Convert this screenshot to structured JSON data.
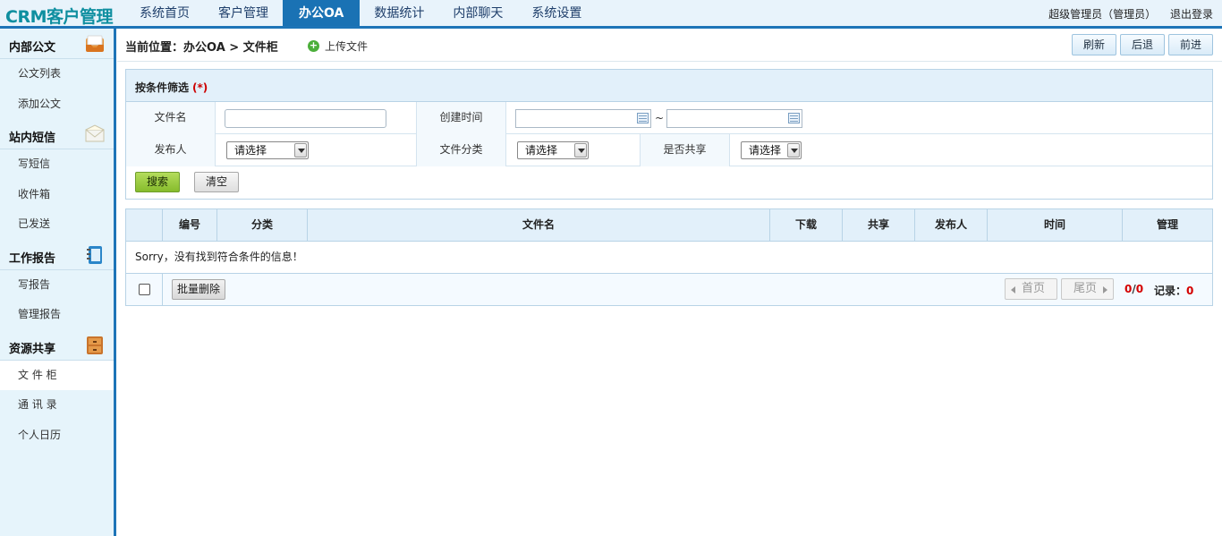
{
  "app": {
    "logo": "CRM客户管理"
  },
  "nav": {
    "items": [
      {
        "label": "系统首页"
      },
      {
        "label": "客户管理"
      },
      {
        "label": "办公OA",
        "active": true
      },
      {
        "label": "数据统计"
      },
      {
        "label": "内部聊天"
      },
      {
        "label": "系统设置"
      }
    ]
  },
  "user": {
    "name": "超级管理员（管理员）",
    "logout": "退出登录"
  },
  "sidebar": {
    "groups": [
      {
        "title": "内部公文",
        "icon": "inbox-tray-icon",
        "items": [
          "公文列表",
          "添加公文"
        ]
      },
      {
        "title": "站内短信",
        "icon": "envelope-icon",
        "items": [
          "写短信",
          "收件箱",
          "已发送"
        ]
      },
      {
        "title": "工作报告",
        "icon": "notebook-icon",
        "items": [
          "写报告",
          "管理报告"
        ]
      },
      {
        "title": "资源共享",
        "icon": "cabinet-icon",
        "items": [
          "文 件 柜",
          "通 讯 录",
          "个人日历"
        ],
        "active_item": "文 件 柜"
      }
    ]
  },
  "crumb": {
    "text": "当前位置：办公OA > 文件柜",
    "upload": "上传文件"
  },
  "toolbar": {
    "refresh": "刷新",
    "back": "后退",
    "forward": "前进"
  },
  "filter": {
    "title": "按条件筛选",
    "required_mark": "(*)",
    "filename_label": "文件名",
    "filename_value": "",
    "created_label": "创建时间",
    "date_from": "",
    "date_to": "",
    "tilde": "~",
    "publisher_label": "发布人",
    "publisher_value": "请选择",
    "category_label": "文件分类",
    "category_value": "请选择",
    "shared_label": "是否共享",
    "shared_value": "请选择",
    "search_btn": "搜索",
    "clear_btn": "清空"
  },
  "table": {
    "headers": [
      "",
      "编号",
      "分类",
      "文件名",
      "下载",
      "共享",
      "发布人",
      "时间",
      "管理"
    ],
    "empty_text": "Sorry，没有找到符合条件的信息！",
    "batch_delete": "批量删除",
    "pager": {
      "first": "首页",
      "last": "尾页",
      "current": "0",
      "total": "0",
      "records_label": "记录：",
      "records": "0"
    }
  }
}
